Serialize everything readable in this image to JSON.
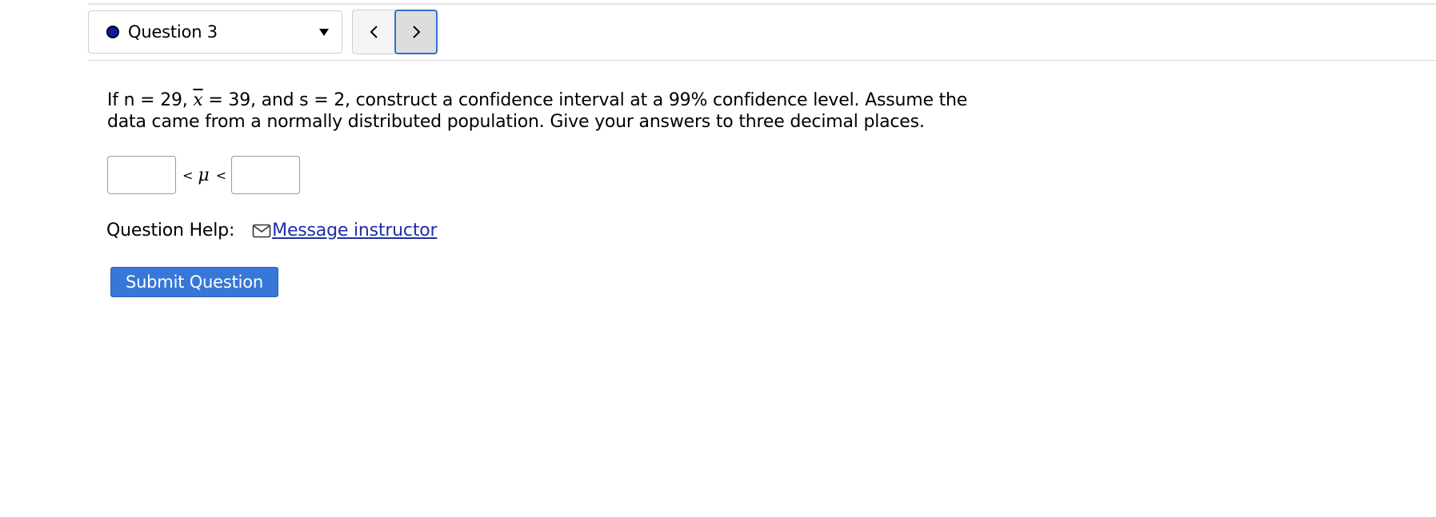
{
  "nav": {
    "question_label": "Question 3",
    "status_color": "#0b1aa6",
    "prev_icon": "chevron-left-icon",
    "next_icon": "chevron-right-icon"
  },
  "question": {
    "text_before_x": "If n = 29, ",
    "x_symbol": "x",
    "text_after_x": " = 39, and s = 2, construct a confidence interval at a 99% confidence level. Assume the data came from a normally distributed population. Give your answers to three decimal places."
  },
  "answer": {
    "lower_value": "",
    "upper_value": "",
    "less_than_1": "<",
    "mu_symbol": "μ",
    "less_than_2": "<"
  },
  "help": {
    "label": "Question Help:",
    "link_text": " Message instructor",
    "link_icon": "mail-icon"
  },
  "submit": {
    "label": "Submit Question",
    "color": "#3777d8"
  }
}
